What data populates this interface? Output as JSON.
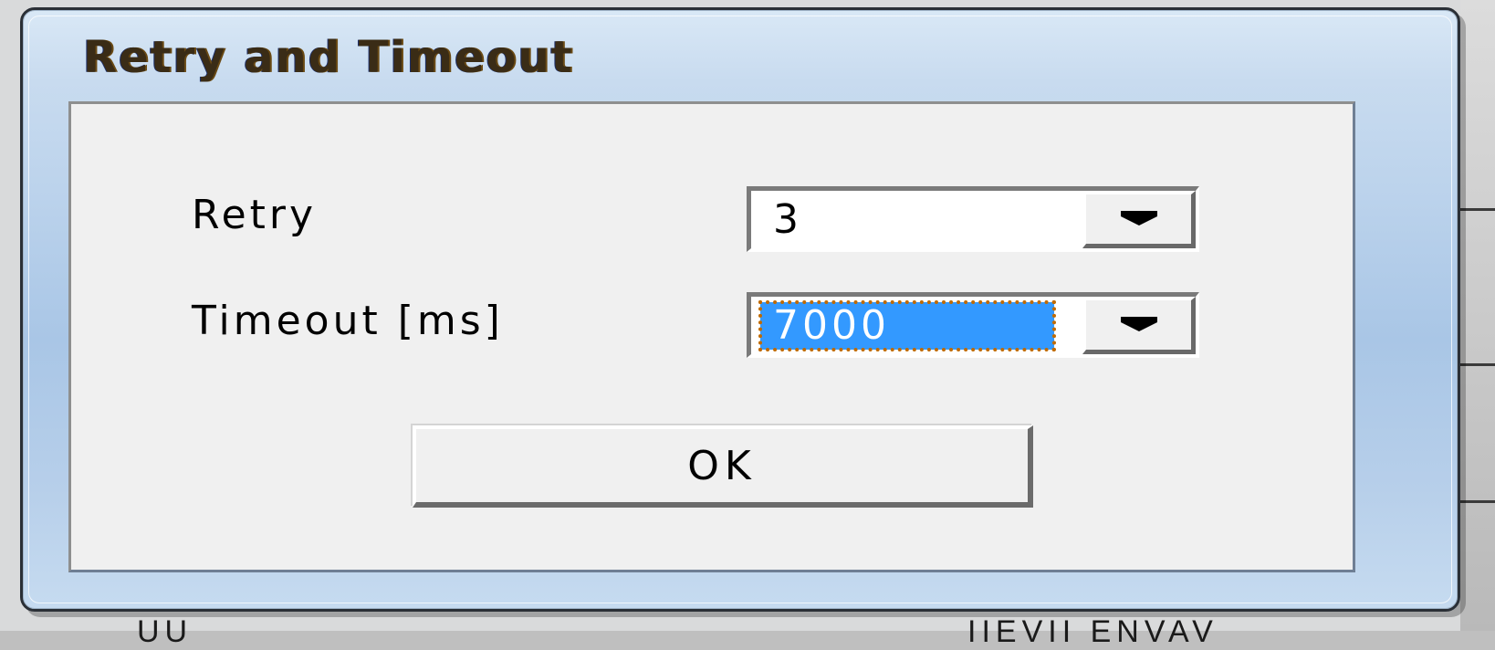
{
  "dialog": {
    "title": "Retry and Timeout"
  },
  "retry": {
    "label": "Retry",
    "value": "3"
  },
  "timeout": {
    "label": "Timeout [ms]",
    "value": "7000",
    "selected": true
  },
  "buttons": {
    "ok_label": "OK"
  },
  "background": {
    "left_text": "UU",
    "right_text": "IIEVII ENVAV"
  },
  "colors": {
    "selection": "#3399ff",
    "client_bg": "#f0f0f0",
    "frame_tint": "#bcd3ec"
  },
  "icons": {
    "dropdown": "chevron-down-icon"
  }
}
